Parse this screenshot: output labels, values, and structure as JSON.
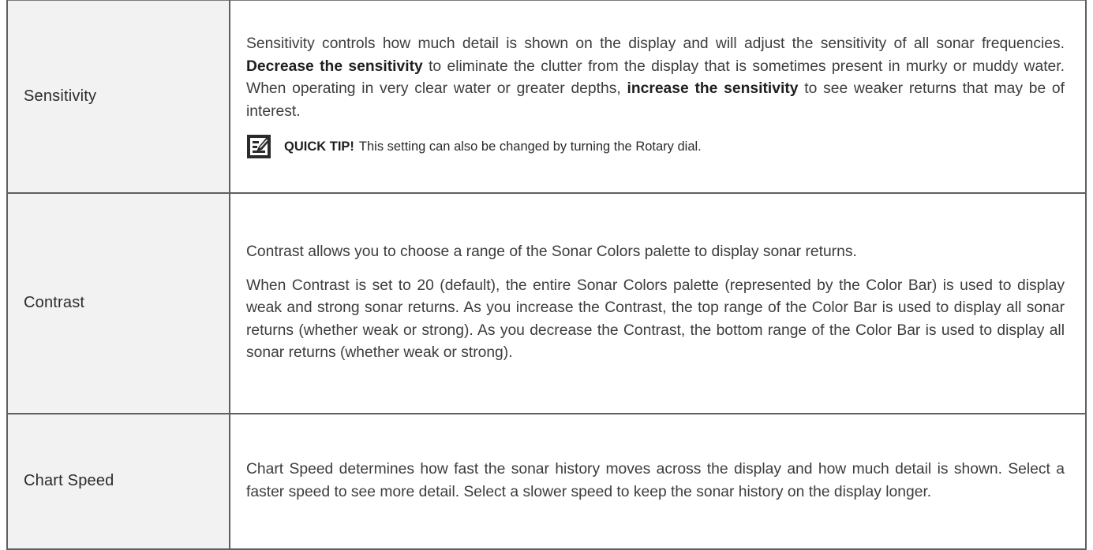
{
  "rows": [
    {
      "label": "Sensitivity",
      "desc_parts": [
        "Sensitivity controls how much detail is shown on the display and will adjust the sensitivity of all sonar frequencies. ",
        "Decrease the sensitivity",
        " to eliminate the clutter from the display that is sometimes present in murky or muddy water. When operating in very clear water or greater depths, ",
        "increase the sensitivity",
        " to see weaker returns that may be of interest."
      ],
      "tip": {
        "icon": "quick-tip-icon",
        "title": "QUICK TIP!",
        "text": "This setting can also be changed by turning the Rotary dial."
      }
    },
    {
      "label": "Contrast",
      "paragraphs": [
        "Contrast allows you to choose a range of the Sonar Colors palette to display sonar returns.",
        "When Contrast is set to 20 (default), the entire Sonar Colors palette (represented by the Color Bar) is used to display weak and strong sonar returns. As you increase the Contrast, the top range of the Color Bar is used to display all sonar returns (whether weak or strong). As you decrease the Contrast, the bottom range of the Color Bar is used to display all sonar returns (whether weak or strong)."
      ]
    },
    {
      "label": "Chart Speed",
      "paragraphs": [
        "Chart Speed determines how fast the sonar history moves across the display and how much detail is shown. Select a faster speed to see more detail. Select a slower speed to keep the sonar history on the display longer."
      ]
    }
  ]
}
